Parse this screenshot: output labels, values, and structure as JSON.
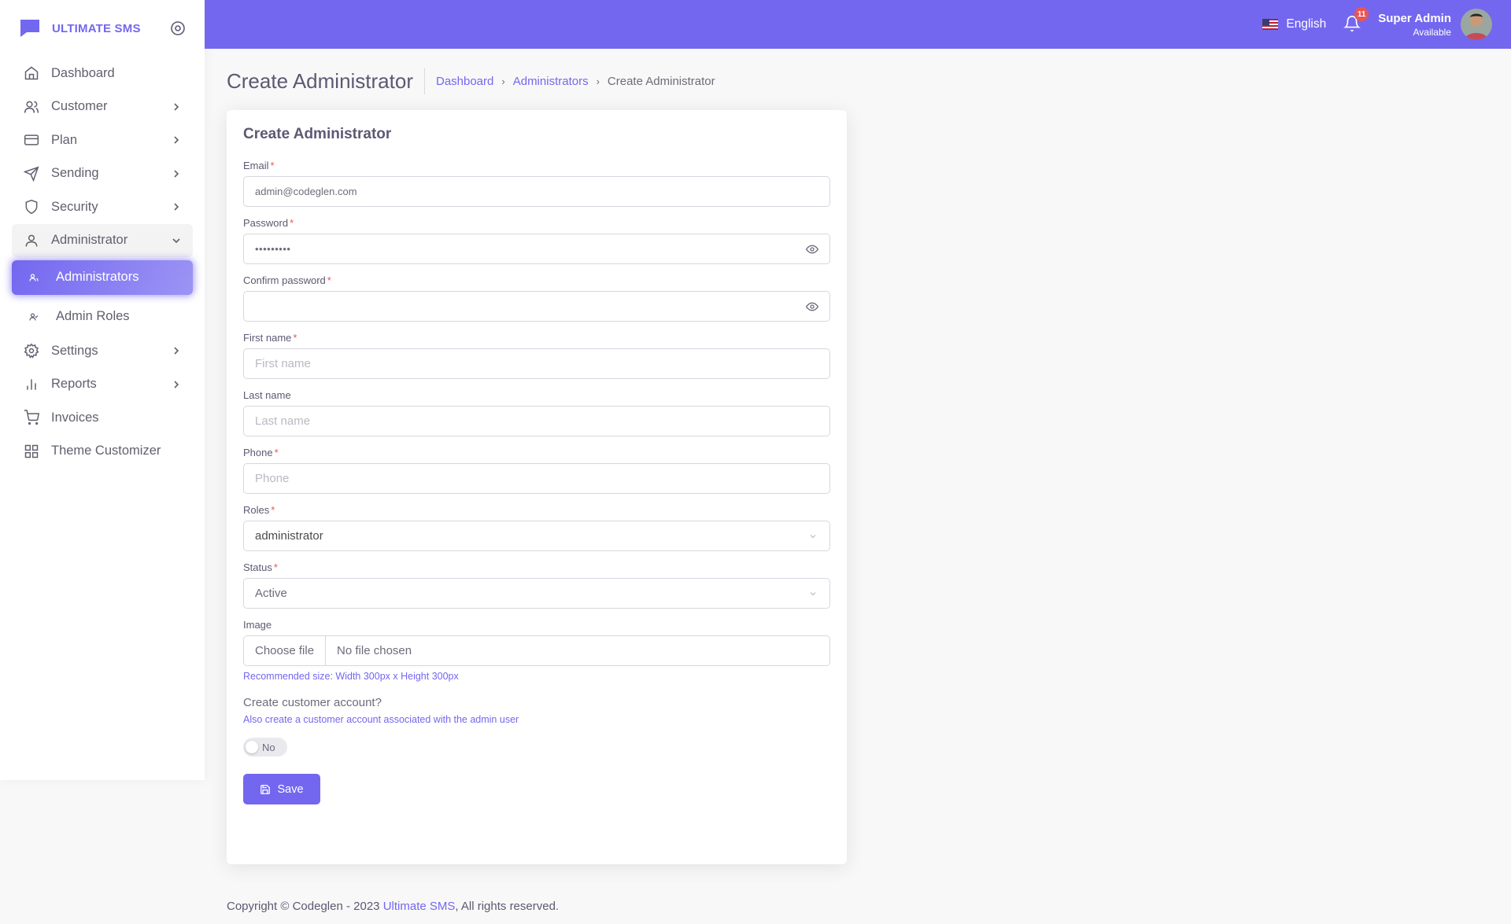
{
  "brand": {
    "name": "ULTIMATE SMS"
  },
  "sidebar": {
    "items": [
      {
        "label": "Dashboard"
      },
      {
        "label": "Customer"
      },
      {
        "label": "Plan"
      },
      {
        "label": "Sending"
      },
      {
        "label": "Security"
      },
      {
        "label": "Administrator"
      },
      {
        "label": "Administrators"
      },
      {
        "label": "Admin Roles"
      },
      {
        "label": "Settings"
      },
      {
        "label": "Reports"
      },
      {
        "label": "Invoices"
      },
      {
        "label": "Theme Customizer"
      }
    ]
  },
  "header": {
    "language": "English",
    "notifications_count": "11",
    "user_name": "Super Admin",
    "user_status": "Available"
  },
  "page": {
    "title": "Create Administrator",
    "breadcrumb": [
      "Dashboard",
      "Administrators",
      "Create Administrator"
    ]
  },
  "form": {
    "card_title": "Create Administrator",
    "email_label": "Email",
    "email_value": "admin@codeglen.com",
    "password_label": "Password",
    "password_value": "•••••••••",
    "confirm_password_label": "Confirm password",
    "first_name_label": "First name",
    "first_name_placeholder": "First name",
    "last_name_label": "Last name",
    "last_name_placeholder": "Last name",
    "phone_label": "Phone",
    "phone_placeholder": "Phone",
    "roles_label": "Roles",
    "roles_value": "administrator",
    "status_label": "Status",
    "status_value": "Active",
    "image_label": "Image",
    "file_button": "Choose file",
    "file_name": "No file chosen",
    "image_hint": "Recommended size: Width 300px x Height 300px",
    "customer_account_title": "Create customer account?",
    "customer_account_desc": "Also create a customer account associated with the admin user",
    "toggle_label": "No",
    "save_label": "Save",
    "required_mark": "*"
  },
  "footer": {
    "prefix": "Copyright © Codeglen - 2023",
    "link": "Ultimate SMS",
    "suffix": ", All rights reserved."
  },
  "colors": {
    "primary": "#7367f0",
    "danger": "#ea5455",
    "text": "#5e5873"
  }
}
